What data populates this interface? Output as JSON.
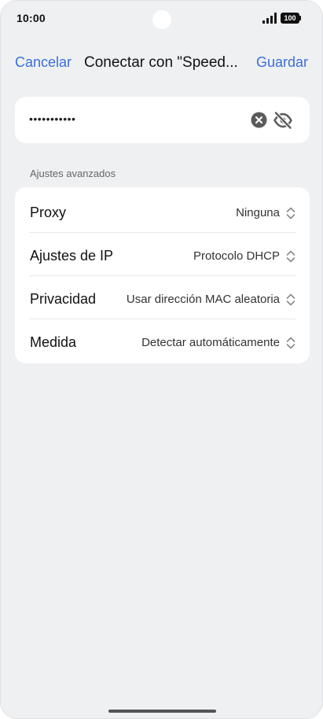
{
  "status_bar": {
    "time": "10:00",
    "battery": "100"
  },
  "header": {
    "cancel_label": "Cancelar",
    "title": "Conectar con \"Speed...",
    "save_label": "Guardar"
  },
  "password": {
    "value": "•••••••••••"
  },
  "advanced": {
    "section_label": "Ajustes avanzados",
    "rows": [
      {
        "label": "Proxy",
        "value": "Ninguna"
      },
      {
        "label": "Ajustes de IP",
        "value": "Protocolo DHCP"
      },
      {
        "label": "Privacidad",
        "value": "Usar dirección MAC aleatoria"
      },
      {
        "label": "Medida",
        "value": "Detectar automáticamente"
      }
    ]
  },
  "colors": {
    "accent": "#3a6fd8",
    "background": "#eff0f2",
    "card": "#ffffff"
  }
}
